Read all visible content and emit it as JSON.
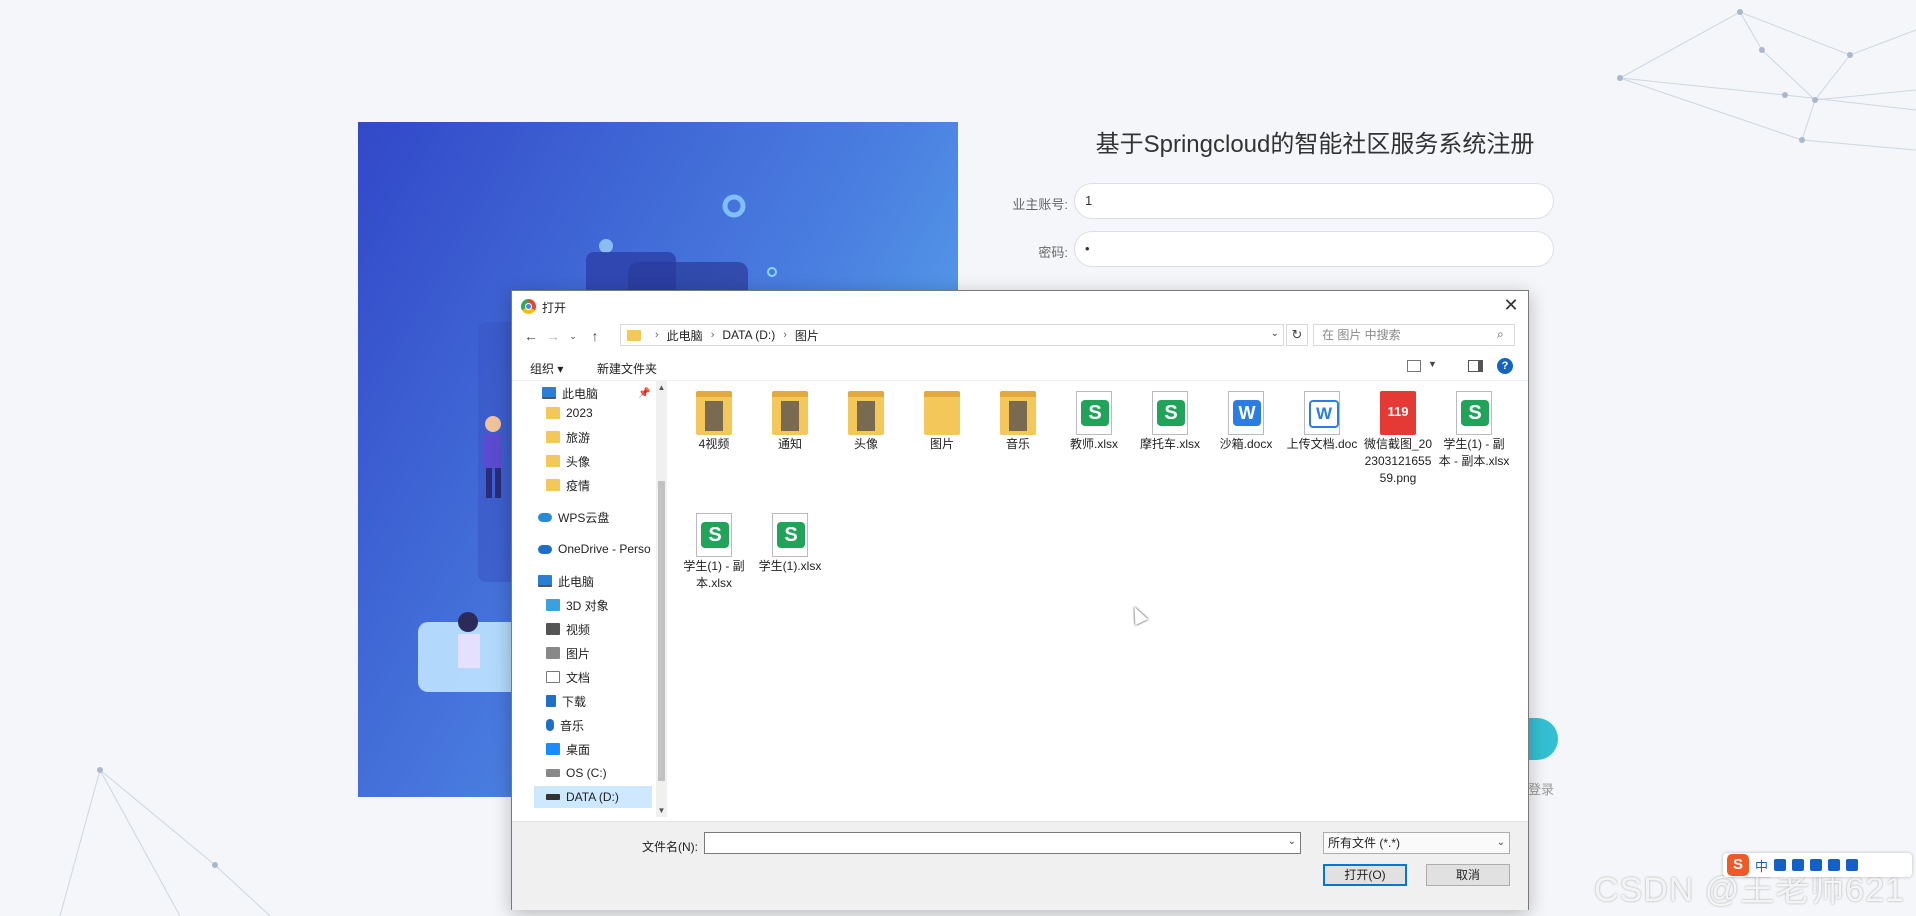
{
  "page": {
    "title": "基于Springcloud的智能社区服务系统注册",
    "form": {
      "account_label": "业主账号:",
      "account_value": "1",
      "password_label": "密码:",
      "password_value": "•"
    },
    "login_tail": "登录",
    "watermark": "CSDN @王老师621"
  },
  "ime": {
    "logo": "S",
    "mode": "中"
  },
  "dialog": {
    "title": "打开",
    "breadcrumb": [
      "此电脑",
      "DATA (D:)",
      "图片"
    ],
    "search_placeholder": "在 图片 中搜索",
    "toolbar": {
      "organize": "组织 ▾",
      "new_folder": "新建文件夹"
    },
    "nav_items": [
      {
        "label": "此电脑",
        "icon": "pc"
      },
      {
        "label": "2023",
        "icon": "folder"
      },
      {
        "label": "旅游",
        "icon": "folder"
      },
      {
        "label": "头像",
        "icon": "folder"
      },
      {
        "label": "疫情",
        "icon": "folder"
      },
      {
        "label": "WPS云盘",
        "icon": "cloud"
      },
      {
        "label": "OneDrive - Perso",
        "icon": "onedrive"
      },
      {
        "label": "此电脑",
        "icon": "pc"
      },
      {
        "label": "3D 对象",
        "icon": "cube"
      },
      {
        "label": "视频",
        "icon": "video"
      },
      {
        "label": "图片",
        "icon": "picture"
      },
      {
        "label": "文档",
        "icon": "document"
      },
      {
        "label": "下载",
        "icon": "download"
      },
      {
        "label": "音乐",
        "icon": "music"
      },
      {
        "label": "桌面",
        "icon": "desktop"
      },
      {
        "label": "OS (C:)",
        "icon": "drive"
      },
      {
        "label": "DATA (D:)",
        "icon": "drive",
        "selected": true
      }
    ],
    "files": [
      {
        "name": "4视频",
        "type": "folder-photo"
      },
      {
        "name": "通知",
        "type": "folder-photo"
      },
      {
        "name": "头像",
        "type": "folder-photo"
      },
      {
        "name": "图片",
        "type": "folder"
      },
      {
        "name": "音乐",
        "type": "folder-photo"
      },
      {
        "name": "教师.xlsx",
        "type": "sheet"
      },
      {
        "name": "摩托车.xlsx",
        "type": "sheet"
      },
      {
        "name": "沙箱.docx",
        "type": "word"
      },
      {
        "name": "上传文档.doc",
        "type": "word-outline"
      },
      {
        "name": "微信截图_20230312165559.png",
        "type": "image"
      },
      {
        "name": "学生(1) - 副本 - 副本.xlsx",
        "type": "sheet"
      },
      {
        "name": "学生(1) - 副本.xlsx",
        "type": "sheet"
      },
      {
        "name": "学生(1).xlsx",
        "type": "sheet"
      }
    ],
    "filename_label": "文件名(N):",
    "filename_value": "",
    "filetype": "所有文件 (*.*)",
    "open_button": "打开(O)",
    "cancel_button": "取消"
  }
}
